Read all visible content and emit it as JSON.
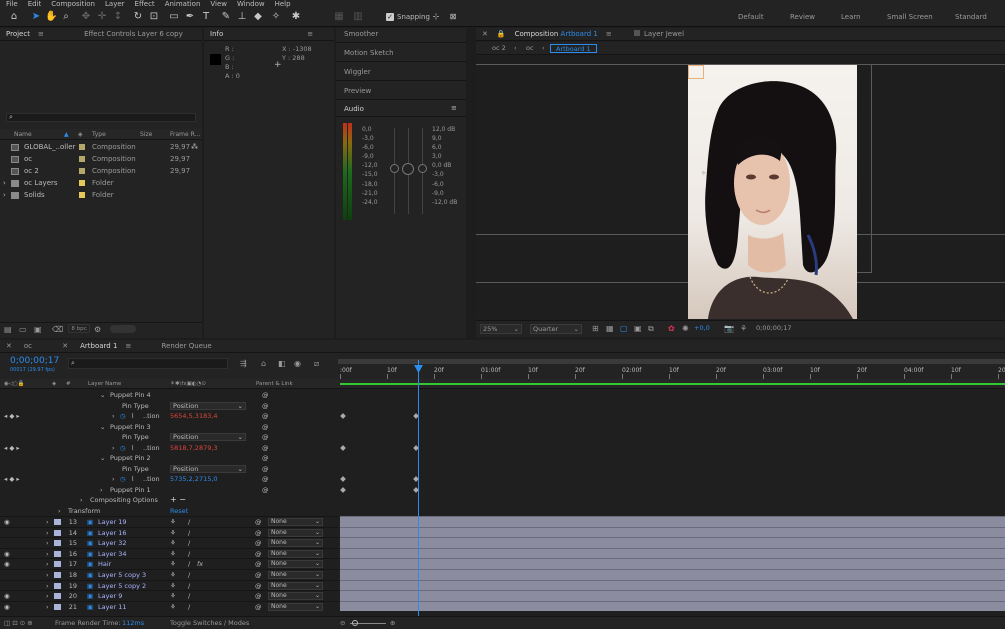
{
  "menu": [
    "File",
    "Edit",
    "Composition",
    "Layer",
    "Effect",
    "Animation",
    "View",
    "Window",
    "Help"
  ],
  "toolbar": {
    "snapping": "Snapping",
    "workspaces": [
      "Default",
      "Review",
      "Learn",
      "Small Screen",
      "Standard"
    ]
  },
  "project": {
    "tab1": "Project",
    "tab2": "Effect Controls",
    "tab2_target": "Layer 6 copy",
    "search_placeholder": "",
    "columns": {
      "name": "Name",
      "type": "Type",
      "size": "Size",
      "frame_rate": "Frame R..."
    },
    "items": [
      {
        "name": "GLOBAL_..oller",
        "type": "Composition",
        "fps": "29,97",
        "color": "#b5a76a"
      },
      {
        "name": "oc",
        "type": "Composition",
        "fps": "29,97",
        "color": "#b5a76a"
      },
      {
        "name": "oc 2",
        "type": "Composition",
        "fps": "29,97",
        "color": "#b5a76a"
      },
      {
        "name": "oc Layers",
        "type": "Folder",
        "fps": "",
        "color": "#e6c85a"
      },
      {
        "name": "Solids",
        "type": "Folder",
        "fps": "",
        "color": "#e6c85a"
      }
    ],
    "bpc": "8 bpc"
  },
  "info": {
    "tab": "Info",
    "r": "R :",
    "g": "G :",
    "b": "B :",
    "a": "A :  0",
    "x": "X : -1308",
    "y": "Y :  288"
  },
  "side": {
    "items": [
      "Smoother",
      "Motion Sketch",
      "Wiggler",
      "Preview"
    ],
    "audio": "Audio",
    "left_scale": [
      "0,0",
      "-3,0",
      "-6,0",
      "-9,0",
      "-12,0",
      "-15,0",
      "-18,0",
      "-21,0",
      "-24,0"
    ],
    "right_scale": [
      "12,0 dB",
      "9,0",
      "6,0",
      "3,0",
      "0,0 dB",
      "-3,0",
      "-6,0",
      "-9,0",
      "-12,0 dB"
    ]
  },
  "comp": {
    "tab_label": "Composition",
    "tab_name": "Artboard 1",
    "layer_tab": "Layer Jewel",
    "crumbs": [
      "oc 2",
      "oc",
      "Artboard 1"
    ],
    "zoom": "25%",
    "quality": "Quarter",
    "exposure": "+0,0",
    "timecode": "0;00;00;17"
  },
  "timeline": {
    "tab_oc": "oc",
    "tab_active": "Artboard 1",
    "render_queue": "Render Queue",
    "timecode": "0;00;00;17",
    "fps_sub": "00017 (29.97 fps)",
    "col_layer_name": "Layer Name",
    "col_parent": "Parent & Link",
    "ruler": [
      ":00f",
      "10f",
      "20f",
      "01:00f",
      "10f",
      "20f",
      "02:00f",
      "10f",
      "20f",
      "03:00f",
      "10f",
      "20f",
      "04:00f",
      "10f",
      "20f"
    ],
    "props": [
      {
        "label": "Puppet Pin 4",
        "indent": 110
      },
      {
        "label": "Pin Type",
        "indent": 122,
        "value": "Position"
      },
      {
        "label": "..tion",
        "indent": 143,
        "value": "5654,5,3183,4",
        "red": true
      },
      {
        "label": "Puppet Pin 3",
        "indent": 110
      },
      {
        "label": "Pin Type",
        "indent": 122,
        "value": "Position"
      },
      {
        "label": "..tion",
        "indent": 143,
        "value": "5818,7,2879,3",
        "red": true
      },
      {
        "label": "Puppet Pin 2",
        "indent": 110
      },
      {
        "label": "Pin Type",
        "indent": 122,
        "value": "Position"
      },
      {
        "label": "..tion",
        "indent": 143,
        "value": "5735,2,2715,0",
        "red": false
      },
      {
        "label": "Puppet Pin 1",
        "indent": 110
      },
      {
        "label": "Compositing Options",
        "indent": 90
      },
      {
        "label": "Transform",
        "indent": 68,
        "value": "Reset"
      }
    ],
    "layers": [
      {
        "num": "13",
        "name": "Layer 19",
        "parent": "None"
      },
      {
        "num": "14",
        "name": "Layer 16",
        "parent": "None"
      },
      {
        "num": "15",
        "name": "Layer 32",
        "parent": "None"
      },
      {
        "num": "16",
        "name": "Layer 34",
        "parent": "None"
      },
      {
        "num": "17",
        "name": "Hair",
        "parent": "None"
      },
      {
        "num": "18",
        "name": "Layer 5 copy 3",
        "parent": "None"
      },
      {
        "num": "19",
        "name": "Layer 5 copy 2",
        "parent": "None"
      },
      {
        "num": "20",
        "name": "Layer 9",
        "parent": "None"
      },
      {
        "num": "21",
        "name": "Layer 11",
        "parent": "None"
      }
    ],
    "frame_render_label": "Frame Render Time:",
    "frame_render_value": "112ms",
    "toggle": "Toggle Switches / Modes"
  },
  "colors": {
    "accent": "#2d8ceb",
    "panel": "#232323",
    "bg": "#1d1d1d"
  }
}
